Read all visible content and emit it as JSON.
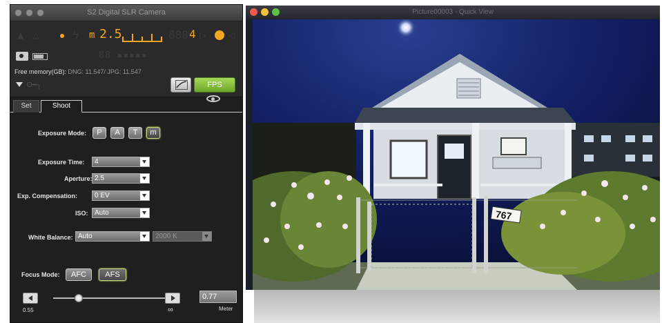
{
  "control_window": {
    "title": "S2 Digital SLR Camera",
    "led": {
      "mode": "m",
      "aperture": "2.5",
      "count": "4",
      "shots_display": "88"
    },
    "free_memory_label": "Free memory(GB):",
    "free_memory_value": "DNG: 11.547/ JPG: 11.547",
    "fps_label": "FPS",
    "tabs": [
      {
        "label": "Set"
      },
      {
        "label": "Shoot"
      }
    ],
    "exposure_mode": {
      "label": "Exposure Mode:",
      "options": [
        "P",
        "A",
        "T",
        "m"
      ],
      "selected": "m"
    },
    "exposure_time": {
      "label": "Exposure Time:",
      "value": "4"
    },
    "aperture": {
      "label": "Aperture:",
      "value": "2.5"
    },
    "exp_compensation": {
      "label": "Exp. Compensation:",
      "value": "0 EV"
    },
    "iso": {
      "label": "ISO:",
      "value": "Auto"
    },
    "white_balance": {
      "label": "White Balance:",
      "value": "Auto",
      "kelvin": "2000 K"
    },
    "focus_mode": {
      "label": "Focus Mode:",
      "options": [
        "AFC",
        "AFS"
      ],
      "selected": "AFS"
    },
    "focus_distance": {
      "min_label": "0.55",
      "max_label": "∞",
      "value": "0.77",
      "unit": "Meter",
      "slider_fraction": 0.22
    }
  },
  "picture_window": {
    "title": "Picture00003 - Quick View",
    "photo_house_number": "767"
  },
  "colors": {
    "led_accent": "#f5a623",
    "fps_green": "#8cc63f",
    "tl_red": "#ee5a4f",
    "tl_yellow": "#f4bf3a",
    "tl_green": "#5fc04a"
  }
}
